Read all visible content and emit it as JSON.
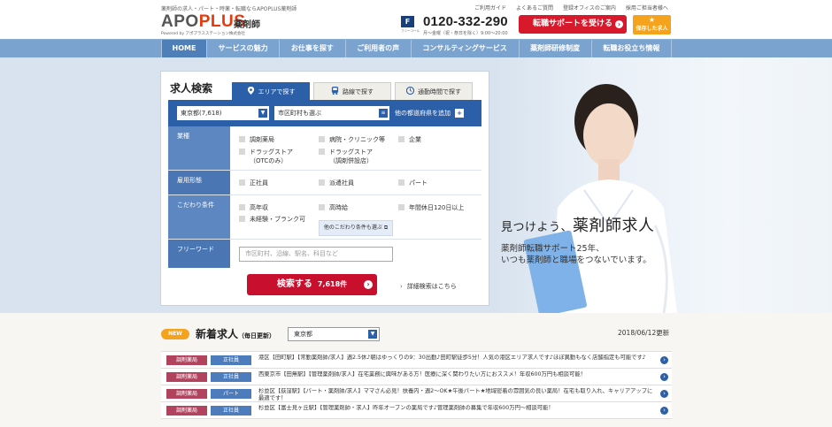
{
  "header": {
    "tagline": "薬剤師の求人・パート・時薬・転職ならAPOPLUS薬剤師",
    "logo": {
      "main_a": "APO",
      "main_b": "PLUS",
      "sub": "薬剤師",
      "powered": "Powered by アポプラスステーション株式会社"
    },
    "top_links": [
      "ご利用ガイド",
      "よくあるご質問",
      "登録オフィスのご案内",
      "採用ご担当者様へ"
    ],
    "phone": {
      "free_label": "フリーコール",
      "number": "0120-332-290",
      "hours": "月〜金曜（祝・祭日を除く）9:00〜20:00"
    },
    "cta_primary": "転職サポートを受ける",
    "cta_saved": "保存した求人"
  },
  "nav": {
    "items": [
      "HOME",
      "サービスの魅力",
      "お仕事を探す",
      "ご利用者の声",
      "コンサルティングサービス",
      "薬剤師研修制度",
      "転職お役立ち情報"
    ]
  },
  "hero": {
    "title_prefix": "見つけよう、",
    "title_main": "薬剤師求人",
    "sub1": "薬剤師転職サポート25年、",
    "sub2": "いつも薬剤師と職場をつないでいます。"
  },
  "search": {
    "title": "求人検索",
    "tabs": [
      "エリアで探す",
      "路線で探す",
      "通勤時間で探す"
    ],
    "prefecture": "東京都(7,618)",
    "city": "市区町村も選ぶ",
    "add_pref": "他の都道府県を追加",
    "filters": {
      "industry": {
        "label": "業種",
        "options": [
          "調剤薬局",
          "病院・クリニック等",
          "企業",
          "ドラッグストア",
          "（OTCのみ）",
          "ドラッグストア",
          "（調剤併設店）"
        ]
      },
      "employment": {
        "label": "雇用形態",
        "options": [
          "正社員",
          "派遣社員",
          "パート"
        ]
      },
      "conditions": {
        "label": "こだわり条件",
        "options": [
          "高年収",
          "高時給",
          "年間休日120日以上",
          "未経験・ブランク可"
        ],
        "more": "他のこだわり条件も選ぶ"
      },
      "freeword": {
        "label": "フリーワード",
        "placeholder": "市区町村、沿線、駅名、科目など"
      }
    },
    "submit": {
      "label": "検索する",
      "count": "7,618件"
    },
    "detail_link": "詳細検索はこちら"
  },
  "new_jobs": {
    "badge": "NEW",
    "title": "新着求人",
    "daily": "（毎日更新）",
    "area": "東京都",
    "updated": "2018/06/12更新",
    "rows": [
      {
        "tag1": "調剤薬局",
        "tag2": "正社員",
        "text": "港区【田町駅】【常勤薬剤師/求人】週2.5休♪朝はゆっくりの9：30出勤♪田町駅徒歩5分！人気の港区エリア求人です♪ほぼ異動もなく店舗指定も可能です♪"
      },
      {
        "tag1": "調剤薬局",
        "tag2": "正社員",
        "text": "西東京市【田無駅】【管理薬剤師/求人】在宅業務に興味がある方！医療に深く関わりたい方におススメ！年収600万円も相談可能！"
      },
      {
        "tag1": "調剤薬局",
        "tag2": "パート",
        "text": "杉並区【荻窪駅】【パート・薬剤師/求人】ママさん必見！扶養内・週2〜OK★午後パート★地域密着の雰囲気の良い薬局！在宅も取り入れ、キャリアアップに最適です！"
      },
      {
        "tag1": "調剤薬局",
        "tag2": "正社員",
        "text": "杉並区【富士見ヶ丘駅】【管理薬剤師・求人】昨年オープンの薬局です♪管理薬剤師の募集で年収600万円〜相談可能！"
      }
    ]
  },
  "colors": {
    "brand_blue": "#2b5fa8",
    "cta_red": "#d8192b",
    "accent_orange": "#f5a21c",
    "nav_blue": "#7aa3cf"
  }
}
